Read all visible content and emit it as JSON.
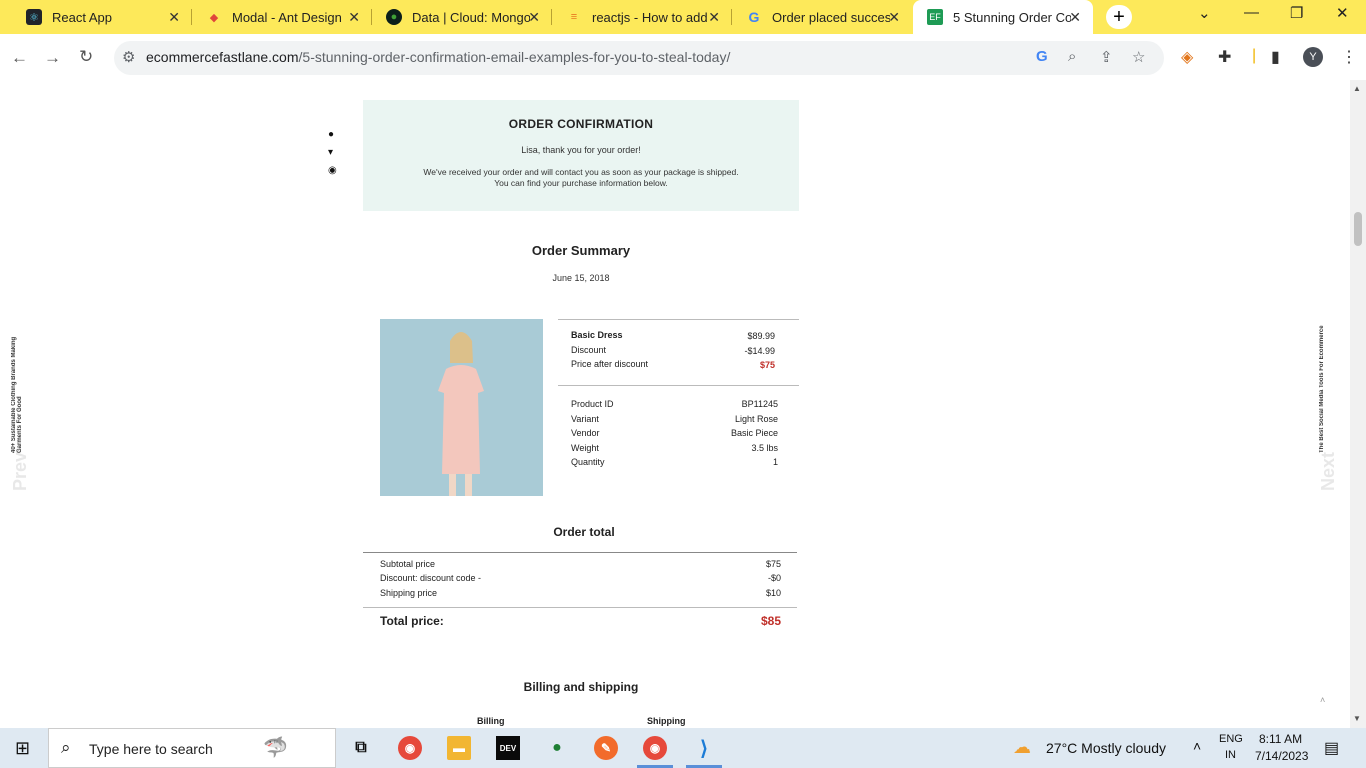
{
  "browser": {
    "tabs": [
      {
        "title": "React App",
        "icon": "react-icon",
        "active": false
      },
      {
        "title": "Modal - Ant Design",
        "icon": "ant-design-icon",
        "active": false
      },
      {
        "title": "Data | Cloud: Mongo",
        "icon": "mongodb-icon",
        "active": false
      },
      {
        "title": "reactjs - How to add",
        "icon": "stackoverflow-icon",
        "active": false
      },
      {
        "title": "Order placed succes",
        "icon": "google-icon",
        "active": false
      },
      {
        "title": "5 Stunning Order Co",
        "icon": "ecommerce-fastlane-icon",
        "active": true
      }
    ],
    "url_domain": "ecommercefastlane.com",
    "url_path": "/5-stunning-order-confirmation-email-examples-for-you-to-steal-today/",
    "profile_initial": "Y"
  },
  "page": {
    "prev_post": "40+ Sustainable Clothing Brands Making Garments For Good",
    "prev_label": "Prev",
    "next_post": "The Best Social Media Tools For Ecommerce",
    "next_label": "Next"
  },
  "email": {
    "heading": "ORDER CONFIRMATION",
    "greeting": "Lisa, thank you for your order!",
    "info": "We've received your order and will contact you as soon as your package is shipped. You can find your purchase information below.",
    "summary_title": "Order Summary",
    "date": "June 15, 2018",
    "item": {
      "name": "Basic Dress",
      "price": "$89.99",
      "discount_label": "Discount",
      "discount": "-$14.99",
      "after_label": "Price after discount",
      "after": "$75"
    },
    "details": [
      {
        "label": "Product ID",
        "value": "BP11245"
      },
      {
        "label": "Variant",
        "value": "Light Rose"
      },
      {
        "label": "Vendor",
        "value": "Basic Piece"
      },
      {
        "label": "Weight",
        "value": "3.5 lbs"
      },
      {
        "label": "Quantity",
        "value": "1"
      }
    ],
    "total_title": "Order total",
    "totals": [
      {
        "label": "Subtotal price",
        "value": "$75"
      },
      {
        "label": "Discount: discount code -",
        "value": "-$0"
      },
      {
        "label": "Shipping price",
        "value": "$10"
      }
    ],
    "total_label": "Total price:",
    "total_value": "$85",
    "billing_title": "Billing and shipping",
    "billing_label": "Billing",
    "shipping_label": "Shipping"
  },
  "taskbar": {
    "search_placeholder": "Type here to search",
    "weather": "27°C  Mostly cloudy",
    "lang1": "ENG",
    "lang2": "IN",
    "time": "8:11 AM",
    "date": "7/14/2023"
  }
}
